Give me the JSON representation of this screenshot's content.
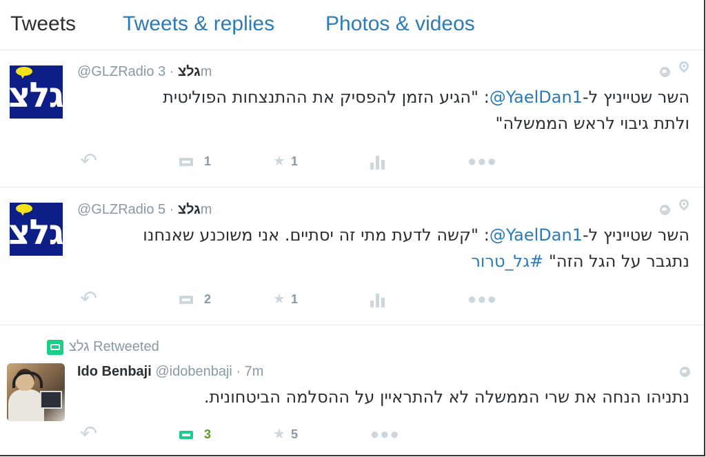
{
  "tabs": [
    {
      "label": "Tweets",
      "active": true
    },
    {
      "label": "Tweets & replies",
      "active": false
    },
    {
      "label": "Photos & videos",
      "active": false
    }
  ],
  "colors": {
    "link": "#2b7bb9",
    "muted": "#8899a6",
    "retweet": "#19cf86"
  },
  "logo_text": "גלצ",
  "tweets": [
    {
      "screen_name": "@GLZRadio",
      "fullname": "גלצ",
      "time": "· 3m",
      "text_line1_pre": "השר שטייניץ ל-",
      "text_line1_mention": "@YaelDan1",
      "text_line1_post": ": \"הגיע הזמן להפסיק את ההתנצחות הפוליטית",
      "text_line2": "ולתת גיבוי לראש הממשלה\"",
      "retweets": "1",
      "favorites": "1"
    },
    {
      "screen_name": "@GLZRadio",
      "fullname": "גלצ",
      "time": "· 5m",
      "text_line1_pre": "השר שטייניץ ל-",
      "text_line1_mention": "@YaelDan1",
      "text_line1_post": ": \"קשה לדעת מתי זה יסתיים. אני משוכנע שאנחנו",
      "text_line2": "נתגבר על הגל הזה\" ",
      "text_line2_hashtag": "#גל_טרור",
      "retweets": "2",
      "favorites": "1"
    },
    {
      "retweet_context": "גלצ Retweeted",
      "fullname": "Ido Benbaji",
      "screen_name": "@idobenbaji",
      "time": "· 7m",
      "text_line1": "נתניהו הנחה את שרי הממשלה לא להתראיין על ההסלמה הביטחונית.",
      "retweets": "3",
      "favorites": "5"
    }
  ]
}
